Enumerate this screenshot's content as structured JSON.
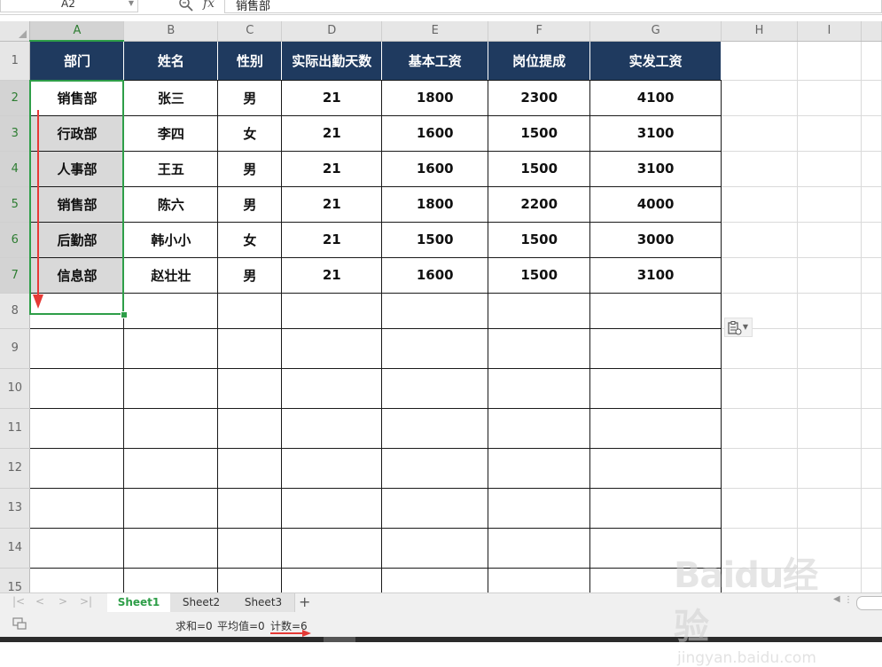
{
  "formula_bar": {
    "name_box": "A2",
    "fx": "fx",
    "content": "销售部"
  },
  "columns": [
    "A",
    "B",
    "C",
    "D",
    "E",
    "F",
    "G",
    "H",
    "I"
  ],
  "rows": [
    "1",
    "2",
    "3",
    "4",
    "5",
    "6",
    "7",
    "8",
    "9",
    "10",
    "11",
    "12",
    "13",
    "14",
    "15"
  ],
  "table": {
    "headers": [
      "部门",
      "姓名",
      "性别",
      "实际出勤天数",
      "基本工资",
      "岗位提成",
      "实发工资"
    ],
    "data": [
      [
        "销售部",
        "张三",
        "男",
        "21",
        "1800",
        "2300",
        "4100"
      ],
      [
        "行政部",
        "李四",
        "女",
        "21",
        "1600",
        "1500",
        "3100"
      ],
      [
        "人事部",
        "王五",
        "男",
        "21",
        "1600",
        "1500",
        "3100"
      ],
      [
        "销售部",
        "陈六",
        "男",
        "21",
        "1800",
        "2200",
        "4000"
      ],
      [
        "后勤部",
        "韩小小",
        "女",
        "21",
        "1500",
        "1500",
        "3000"
      ],
      [
        "信息部",
        "赵壮壮",
        "男",
        "21",
        "1600",
        "1500",
        "3100"
      ]
    ],
    "header_color": "#1f3a5f",
    "selection_color": "#2e9e48",
    "annotation_arrow_color": "#e53935"
  },
  "sheet_tabs": {
    "tabs": [
      "Sheet1",
      "Sheet2",
      "Sheet3"
    ],
    "active": "Sheet1",
    "add": "+"
  },
  "status_bar": {
    "sum": "求和=0",
    "average": "平均值=0",
    "count": "计数=6"
  },
  "watermark": {
    "logo": "Baidu经验",
    "sub": "jingyan.baidu.com"
  }
}
